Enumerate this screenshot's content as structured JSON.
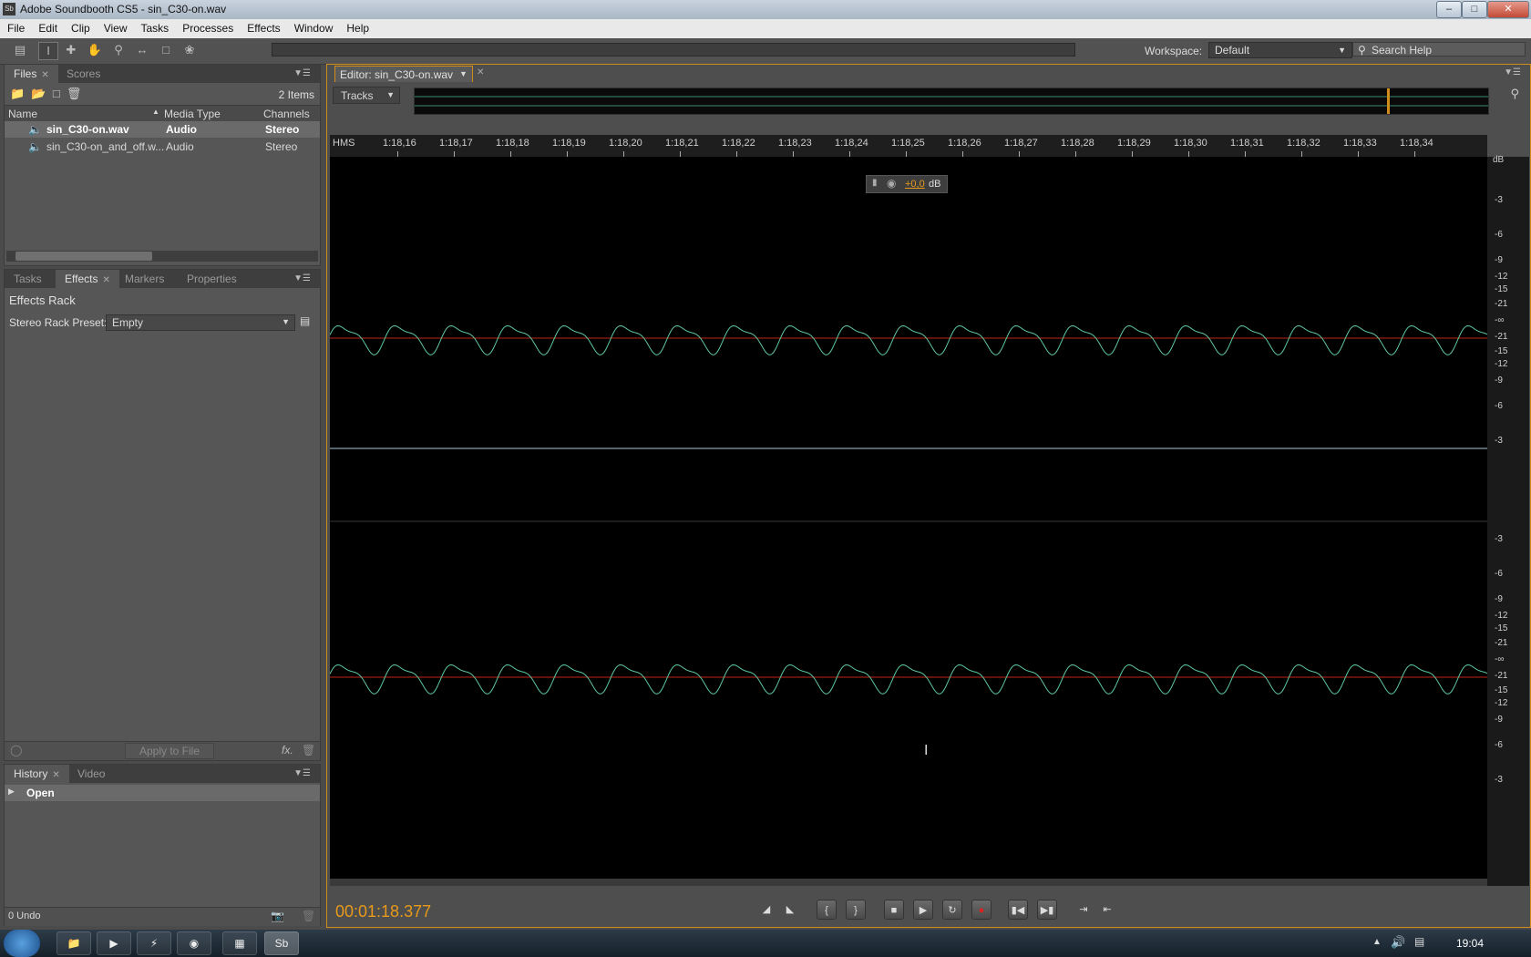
{
  "window": {
    "title": "Adobe Soundbooth CS5 - sin_C30-on.wav",
    "app_badge": "Sb"
  },
  "menu": [
    "File",
    "Edit",
    "Clip",
    "View",
    "Tasks",
    "Processes",
    "Effects",
    "Window",
    "Help"
  ],
  "toolbar": {
    "workspace_label": "Workspace:",
    "workspace_value": "Default",
    "search_placeholder": "Search Help"
  },
  "files_panel": {
    "tabs": [
      "Files",
      "Scores"
    ],
    "item_count": "2 Items",
    "columns": [
      "Name",
      "Media Type",
      "Channels"
    ],
    "rows": [
      {
        "name": "sin_C30-on.wav",
        "type": "Audio",
        "channels": "Stereo"
      },
      {
        "name": "sin_C30-on_and_off.w...",
        "type": "Audio",
        "channels": "Stereo"
      }
    ]
  },
  "effects_panel": {
    "tabs": [
      "Tasks",
      "Effects",
      "Markers",
      "Properties"
    ],
    "title": "Effects Rack",
    "preset_label": "Stereo Rack Preset:",
    "preset_value": "Empty",
    "apply_label": "Apply to File",
    "fx_label": "fx."
  },
  "history_panel": {
    "tabs": [
      "History",
      "Video"
    ],
    "items": [
      "Open"
    ],
    "undo_count": "0 Undo"
  },
  "editor": {
    "tab_label": "Editor: sin_C30-on.wav",
    "view_mode": "Tracks",
    "ruler_unit": "HMS",
    "ruler_ticks": [
      "1:18,16",
      "1:18,17",
      "1:18,18",
      "1:18,19",
      "1:18,20",
      "1:18,21",
      "1:18,22",
      "1:18,23",
      "1:18,24",
      "1:18,25",
      "1:18,26",
      "1:18,27",
      "1:18,28",
      "1:18,29",
      "1:18,30",
      "1:18,31",
      "1:18,32",
      "1:18,33",
      "1:18,34"
    ],
    "db_unit": "dB",
    "db_top": [
      "-3",
      "-6",
      "-9",
      "-12",
      "-15",
      "-21",
      "-∞",
      "-21",
      "-15",
      "-12",
      "-9",
      "-6",
      "-3"
    ],
    "db_bottom": [
      "-3",
      "-6",
      "-9",
      "-12",
      "-15",
      "-21",
      "-∞",
      "-21",
      "-15",
      "-12",
      "-9",
      "-6",
      "-3"
    ],
    "gain_value": "+0,0",
    "gain_unit": "dB",
    "timecode": "00:01:18.377"
  },
  "taskbar": {
    "clock": "19:04"
  },
  "colors": {
    "accent": "#e89a1a",
    "waveform": "#5fc9a0",
    "zero_line": "#c0261a"
  }
}
